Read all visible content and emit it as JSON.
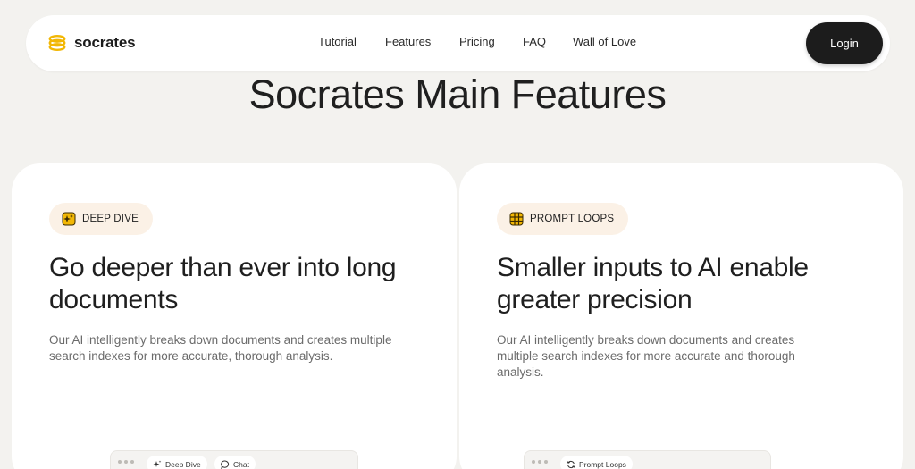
{
  "brand": {
    "name": "socrates",
    "accent": "#f2b705"
  },
  "nav": {
    "links": [
      "Tutorial",
      "Features",
      "Pricing",
      "FAQ",
      "Wall of Love"
    ],
    "login_label": "Login"
  },
  "section": {
    "title": "Socrates Main Features"
  },
  "cards": [
    {
      "badge": "DEEP DIVE",
      "badge_icon": "sparkle-icon",
      "heading": "Go deeper than ever into long documents",
      "description": "Our AI intelligently breaks down documents and creates multiple search indexes for more accurate, thorough analysis.",
      "preview_tabs": [
        "Deep Dive",
        "Chat"
      ]
    },
    {
      "badge": "PROMPT LOOPS",
      "badge_icon": "grid-icon",
      "heading": "Smaller inputs to AI enable greater precision",
      "description": "Our AI intelligently breaks down documents and creates multiple search indexes for more accurate and thorough analysis.",
      "preview_tabs": [
        "Prompt Loops"
      ]
    }
  ],
  "colors": {
    "background": "#f3f2ef",
    "badge_bg": "#fbf1e6",
    "dark": "#1c1c1c"
  }
}
